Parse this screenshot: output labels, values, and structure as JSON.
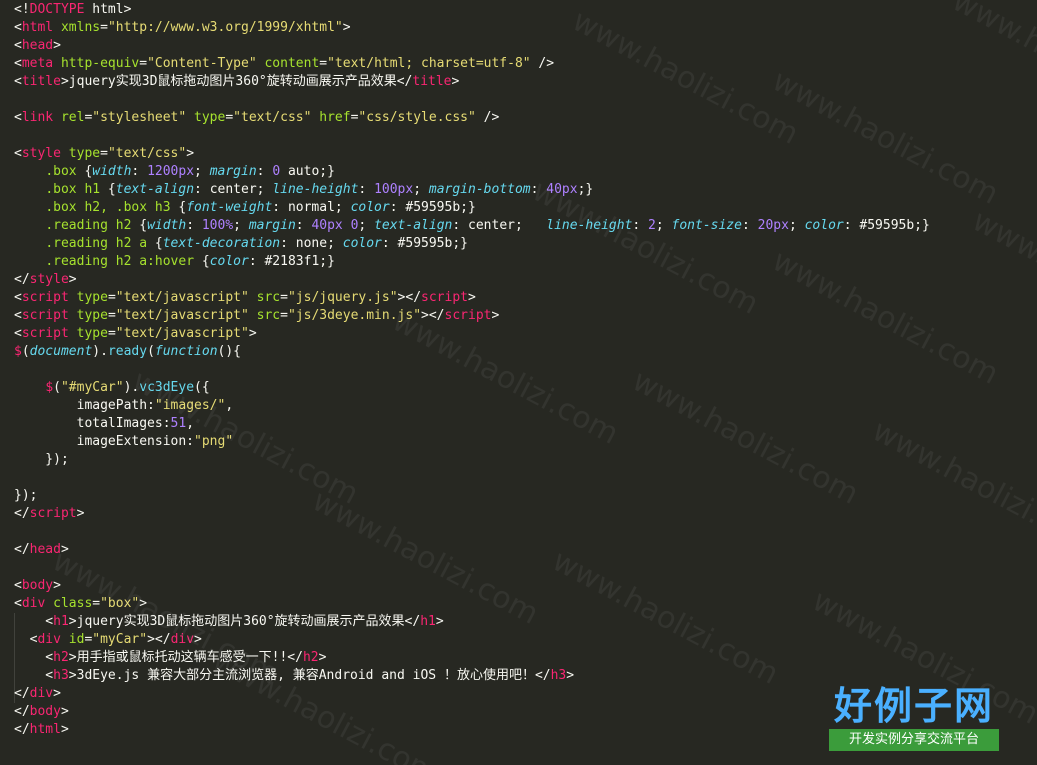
{
  "editor": {
    "lines": [
      [
        [
          "t-punc",
          "<!"
        ],
        [
          "t-tag",
          "DOCTYPE"
        ],
        [
          "t-punc",
          " html>"
        ]
      ],
      [
        [
          "t-punc",
          "<"
        ],
        [
          "t-tag",
          "html"
        ],
        [
          "t-punc",
          " "
        ],
        [
          "t-attr",
          "xmlns"
        ],
        [
          "t-punc",
          "="
        ],
        [
          "t-str",
          "\"http://www.w3.org/1999/xhtml\""
        ],
        [
          "t-punc",
          ">"
        ]
      ],
      [
        [
          "t-punc",
          "<"
        ],
        [
          "t-tag",
          "head"
        ],
        [
          "t-punc",
          ">"
        ]
      ],
      [
        [
          "t-punc",
          "<"
        ],
        [
          "t-tag",
          "meta"
        ],
        [
          "t-punc",
          " "
        ],
        [
          "t-attr",
          "http-equiv"
        ],
        [
          "t-punc",
          "="
        ],
        [
          "t-str",
          "\"Content-Type\""
        ],
        [
          "t-punc",
          " "
        ],
        [
          "t-attr",
          "content"
        ],
        [
          "t-punc",
          "="
        ],
        [
          "t-str",
          "\"text/html; charset=utf-8\""
        ],
        [
          "t-punc",
          " />"
        ]
      ],
      [
        [
          "t-punc",
          "<"
        ],
        [
          "t-tag",
          "title"
        ],
        [
          "t-punc",
          ">"
        ],
        [
          "t-text",
          "jquery实现3D鼠标拖动图片360°旋转动画展示产品效果"
        ],
        [
          "t-punc",
          "</"
        ],
        [
          "t-tag",
          "title"
        ],
        [
          "t-punc",
          ">"
        ]
      ],
      [],
      [
        [
          "t-punc",
          "<"
        ],
        [
          "t-tag",
          "link"
        ],
        [
          "t-punc",
          " "
        ],
        [
          "t-attr",
          "rel"
        ],
        [
          "t-punc",
          "="
        ],
        [
          "t-str",
          "\"stylesheet\""
        ],
        [
          "t-punc",
          " "
        ],
        [
          "t-attr",
          "type"
        ],
        [
          "t-punc",
          "="
        ],
        [
          "t-str",
          "\"text/css\""
        ],
        [
          "t-punc",
          " "
        ],
        [
          "t-attr",
          "href"
        ],
        [
          "t-punc",
          "="
        ],
        [
          "t-str",
          "\"css/style.css\""
        ],
        [
          "t-punc",
          " />"
        ]
      ],
      [],
      [
        [
          "t-punc",
          "<"
        ],
        [
          "t-tag",
          "style"
        ],
        [
          "t-punc",
          " "
        ],
        [
          "t-attr",
          "type"
        ],
        [
          "t-punc",
          "="
        ],
        [
          "t-str",
          "\"text/css\""
        ],
        [
          "t-punc",
          ">"
        ]
      ],
      [
        [
          "t-punc",
          "    "
        ],
        [
          "t-sel",
          ".box"
        ],
        [
          "t-punc",
          " {"
        ],
        [
          "t-prop",
          "width"
        ],
        [
          "t-punc",
          ": "
        ],
        [
          "t-num",
          "1200px"
        ],
        [
          "t-punc",
          "; "
        ],
        [
          "t-prop",
          "margin"
        ],
        [
          "t-punc",
          ": "
        ],
        [
          "t-num",
          "0"
        ],
        [
          "t-punc",
          " auto;}"
        ]
      ],
      [
        [
          "t-punc",
          "    "
        ],
        [
          "t-sel",
          ".box h1"
        ],
        [
          "t-punc",
          " {"
        ],
        [
          "t-prop",
          "text-align"
        ],
        [
          "t-punc",
          ": center; "
        ],
        [
          "t-prop",
          "line-height"
        ],
        [
          "t-punc",
          ": "
        ],
        [
          "t-num",
          "100px"
        ],
        [
          "t-punc",
          "; "
        ],
        [
          "t-prop",
          "margin-bottom"
        ],
        [
          "t-punc",
          ": "
        ],
        [
          "t-num",
          "40px"
        ],
        [
          "t-punc",
          ";}"
        ]
      ],
      [
        [
          "t-punc",
          "    "
        ],
        [
          "t-sel",
          ".box h2, .box h3"
        ],
        [
          "t-punc",
          " {"
        ],
        [
          "t-prop",
          "font-weight"
        ],
        [
          "t-punc",
          ": normal; "
        ],
        [
          "t-prop",
          "color"
        ],
        [
          "t-punc",
          ": #59595b;}"
        ]
      ],
      [
        [
          "t-punc",
          "    "
        ],
        [
          "t-sel",
          ".reading h2"
        ],
        [
          "t-punc",
          " {"
        ],
        [
          "t-prop",
          "width"
        ],
        [
          "t-punc",
          ": "
        ],
        [
          "t-num",
          "100%"
        ],
        [
          "t-punc",
          "; "
        ],
        [
          "t-prop",
          "margin"
        ],
        [
          "t-punc",
          ": "
        ],
        [
          "t-num",
          "40px 0"
        ],
        [
          "t-punc",
          "; "
        ],
        [
          "t-prop",
          "text-align"
        ],
        [
          "t-punc",
          ": center;   "
        ],
        [
          "t-prop",
          "line-height"
        ],
        [
          "t-punc",
          ": "
        ],
        [
          "t-num",
          "2"
        ],
        [
          "t-punc",
          "; "
        ],
        [
          "t-prop",
          "font-size"
        ],
        [
          "t-punc",
          ": "
        ],
        [
          "t-num",
          "20px"
        ],
        [
          "t-punc",
          "; "
        ],
        [
          "t-prop",
          "color"
        ],
        [
          "t-punc",
          ": #59595b;}"
        ]
      ],
      [
        [
          "t-punc",
          "    "
        ],
        [
          "t-sel",
          ".reading h2 a"
        ],
        [
          "t-punc",
          " {"
        ],
        [
          "t-prop",
          "text-decoration"
        ],
        [
          "t-punc",
          ": none; "
        ],
        [
          "t-prop",
          "color"
        ],
        [
          "t-punc",
          ": #59595b;}"
        ]
      ],
      [
        [
          "t-punc",
          "    "
        ],
        [
          "t-sel",
          ".reading h2 a:hover"
        ],
        [
          "t-punc",
          " {"
        ],
        [
          "t-prop",
          "color"
        ],
        [
          "t-punc",
          ": #2183f1;}"
        ]
      ],
      [
        [
          "t-punc",
          "</"
        ],
        [
          "t-tag",
          "style"
        ],
        [
          "t-punc",
          ">"
        ]
      ],
      [
        [
          "t-punc",
          "<"
        ],
        [
          "t-tag",
          "script"
        ],
        [
          "t-punc",
          " "
        ],
        [
          "t-attr",
          "type"
        ],
        [
          "t-punc",
          "="
        ],
        [
          "t-str",
          "\"text/javascript\""
        ],
        [
          "t-punc",
          " "
        ],
        [
          "t-attr",
          "src"
        ],
        [
          "t-punc",
          "="
        ],
        [
          "t-str",
          "\"js/jquery.js\""
        ],
        [
          "t-punc",
          "></"
        ],
        [
          "t-tag",
          "script"
        ],
        [
          "t-punc",
          ">"
        ]
      ],
      [
        [
          "t-punc",
          "<"
        ],
        [
          "t-tag",
          "script"
        ],
        [
          "t-punc",
          " "
        ],
        [
          "t-attr",
          "type"
        ],
        [
          "t-punc",
          "="
        ],
        [
          "t-str",
          "\"text/javascript\""
        ],
        [
          "t-punc",
          " "
        ],
        [
          "t-attr",
          "src"
        ],
        [
          "t-punc",
          "="
        ],
        [
          "t-str",
          "\"js/3deye.min.js\""
        ],
        [
          "t-punc",
          "></"
        ],
        [
          "t-tag",
          "script"
        ],
        [
          "t-punc",
          ">"
        ]
      ],
      [
        [
          "t-punc",
          "<"
        ],
        [
          "t-tag",
          "script"
        ],
        [
          "t-punc",
          " "
        ],
        [
          "t-attr",
          "type"
        ],
        [
          "t-punc",
          "="
        ],
        [
          "t-str",
          "\"text/javascript\""
        ],
        [
          "t-punc",
          ">"
        ]
      ],
      [
        [
          "t-tag",
          "$"
        ],
        [
          "t-punc",
          "("
        ],
        [
          "t-kw",
          "document"
        ],
        [
          "t-punc",
          ")."
        ],
        [
          "t-fn",
          "ready"
        ],
        [
          "t-punc",
          "("
        ],
        [
          "t-kw",
          "function"
        ],
        [
          "t-punc",
          "(){"
        ]
      ],
      [],
      [
        [
          "t-punc",
          "    "
        ],
        [
          "t-tag",
          "$"
        ],
        [
          "t-punc",
          "("
        ],
        [
          "t-str",
          "\"#myCar\""
        ],
        [
          "t-punc",
          ")."
        ],
        [
          "t-fn",
          "vc3dEye"
        ],
        [
          "t-punc",
          "({"
        ]
      ],
      [
        [
          "t-punc",
          "        imagePath:"
        ],
        [
          "t-str",
          "\"images/\""
        ],
        [
          "t-punc",
          ","
        ]
      ],
      [
        [
          "t-punc",
          "        totalImages:"
        ],
        [
          "t-num",
          "51"
        ],
        [
          "t-punc",
          ","
        ]
      ],
      [
        [
          "t-punc",
          "        imageExtension:"
        ],
        [
          "t-str",
          "\"png\""
        ]
      ],
      [
        [
          "t-punc",
          "    });"
        ]
      ],
      [],
      [
        [
          "t-punc",
          "});"
        ]
      ],
      [
        [
          "t-punc",
          "</"
        ],
        [
          "t-tag",
          "script"
        ],
        [
          "t-punc",
          ">"
        ]
      ],
      [],
      [
        [
          "t-punc",
          "</"
        ],
        [
          "t-tag",
          "head"
        ],
        [
          "t-punc",
          ">"
        ]
      ],
      [],
      [
        [
          "t-punc",
          "<"
        ],
        [
          "t-tag",
          "body"
        ],
        [
          "t-punc",
          ">"
        ]
      ],
      [
        [
          "t-punc",
          "<"
        ],
        [
          "t-tag",
          "div"
        ],
        [
          "t-punc",
          " "
        ],
        [
          "t-attr",
          "class"
        ],
        [
          "t-punc",
          "="
        ],
        [
          "t-str",
          "\"box\""
        ],
        [
          "t-punc",
          ">"
        ]
      ],
      [
        [
          "t-punc",
          "    <"
        ],
        [
          "t-tag",
          "h1"
        ],
        [
          "t-punc",
          ">"
        ],
        [
          "t-text",
          "jquery实现3D鼠标拖动图片360°旋转动画展示产品效果"
        ],
        [
          "t-punc",
          "</"
        ],
        [
          "t-tag",
          "h1"
        ],
        [
          "t-punc",
          ">"
        ]
      ],
      [
        [
          "t-punc",
          "  <"
        ],
        [
          "t-tag",
          "div"
        ],
        [
          "t-punc",
          " "
        ],
        [
          "t-attr",
          "id"
        ],
        [
          "t-punc",
          "="
        ],
        [
          "t-str",
          "\"myCar\""
        ],
        [
          "t-punc",
          "></"
        ],
        [
          "t-tag",
          "div"
        ],
        [
          "t-punc",
          ">"
        ]
      ],
      [
        [
          "t-punc",
          "    <"
        ],
        [
          "t-tag",
          "h2"
        ],
        [
          "t-punc",
          ">"
        ],
        [
          "t-text",
          "用手指或鼠标托动这辆车感受一下!!"
        ],
        [
          "t-punc",
          "</"
        ],
        [
          "t-tag",
          "h2"
        ],
        [
          "t-punc",
          ">"
        ]
      ],
      [
        [
          "t-punc",
          "    <"
        ],
        [
          "t-tag",
          "h3"
        ],
        [
          "t-punc",
          ">"
        ],
        [
          "t-text",
          "3dEye.js 兼容大部分主流浏览器, 兼容Android and iOS ！放心使用吧！"
        ],
        [
          "t-punc",
          "</"
        ],
        [
          "t-tag",
          "h3"
        ],
        [
          "t-punc",
          ">"
        ]
      ],
      [
        [
          "t-punc",
          "</"
        ],
        [
          "t-tag",
          "div"
        ],
        [
          "t-punc",
          ">"
        ]
      ],
      [
        [
          "t-punc",
          "</"
        ],
        [
          "t-tag",
          "body"
        ],
        [
          "t-punc",
          ">"
        ]
      ],
      [
        [
          "t-punc",
          "</"
        ],
        [
          "t-tag",
          "html"
        ],
        [
          "t-punc",
          ">"
        ]
      ]
    ]
  },
  "watermark": {
    "text": "www.haolizi.com"
  },
  "logo": {
    "title": "好例子网",
    "subtitle": "开发实例分享交流平台",
    "title_color": "#4ab0ff",
    "subtitle_bg": "#3b9c3b"
  },
  "theme": {
    "background": "#272822",
    "tag": "#f92672",
    "attr": "#a6e22e",
    "string": "#e6db74",
    "number": "#ae81ff",
    "keyword": "#66d9ef"
  }
}
